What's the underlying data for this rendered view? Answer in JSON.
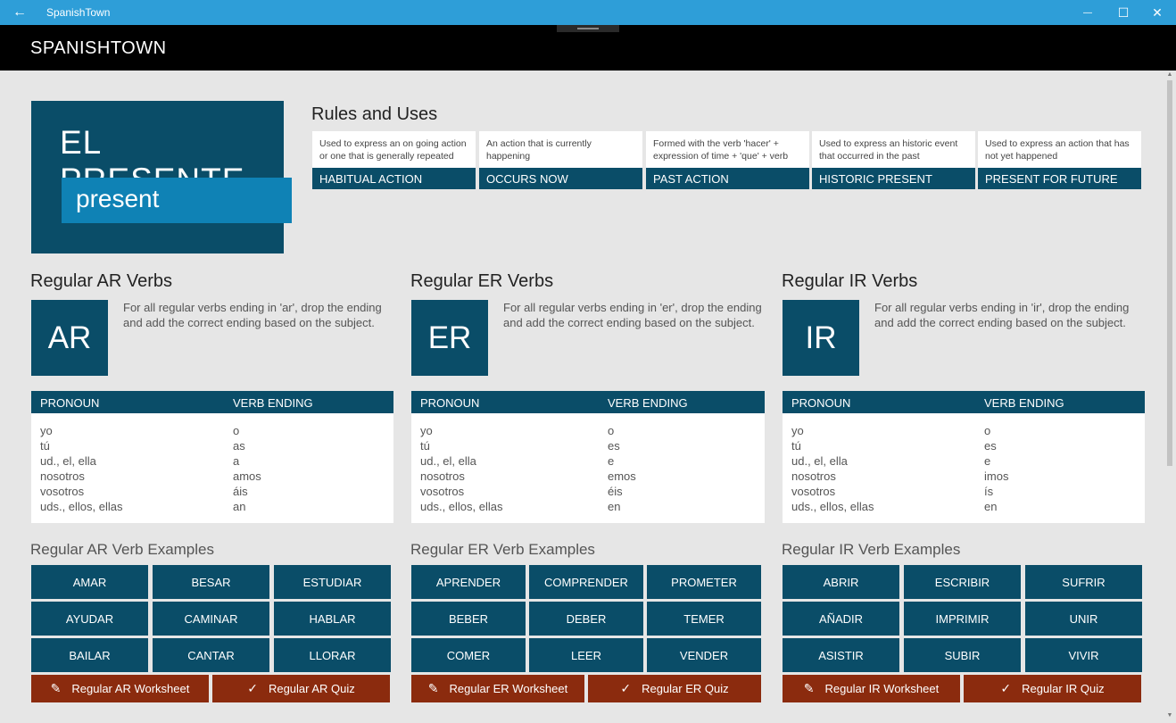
{
  "window": {
    "title": "SpanishTown",
    "back_icon": "←",
    "min_icon": "—",
    "max_icon": "☐",
    "close_icon": "✕"
  },
  "app": {
    "title": "SPANISHTOWN"
  },
  "hero": {
    "title": "EL PRESENTE",
    "subtitle": "present"
  },
  "rules": {
    "title": "Rules and Uses",
    "items": [
      {
        "desc": "Used to express an on going action or one that is generally repeated",
        "label": "HABITUAL ACTION"
      },
      {
        "desc": "An action that is currently happening",
        "label": "OCCURS NOW"
      },
      {
        "desc": "Formed with the verb 'hacer' + expression of time + 'que' + verb",
        "label": "PAST ACTION"
      },
      {
        "desc": "Used to express an historic event that occurred in the past",
        "label": "HISTORIC PRESENT"
      },
      {
        "desc": "Used to express an action that has not yet happened",
        "label": "PRESENT FOR FUTURE"
      }
    ]
  },
  "table_headers": {
    "pronoun": "PRONOUN",
    "ending": "VERB ENDING"
  },
  "pronouns": [
    "yo",
    "tú",
    "ud., el, ella",
    "nosotros",
    "vosotros",
    "uds., ellos, ellas"
  ],
  "columns": [
    {
      "heading": "Regular AR Verbs",
      "badge": "AR",
      "explanation": "For all regular verbs ending in 'ar', drop the ending and add the correct ending based on the subject.",
      "endings": [
        "o",
        "as",
        "a",
        "amos",
        "áis",
        "an"
      ],
      "examples_heading": "Regular AR Verb Examples",
      "verbs": [
        "AMAR",
        "BESAR",
        "ESTUDIAR",
        "AYUDAR",
        "CAMINAR",
        "HABLAR",
        "BAILAR",
        "CANTAR",
        "LLORAR"
      ],
      "worksheet": "Regular AR Worksheet",
      "quiz": "Regular AR Quiz"
    },
    {
      "heading": "Regular ER Verbs",
      "badge": "ER",
      "explanation": "For all regular verbs ending in 'er', drop the ending and add the correct ending based on the subject.",
      "endings": [
        "o",
        "es",
        "e",
        "emos",
        "éis",
        "en"
      ],
      "examples_heading": "Regular ER Verb Examples",
      "verbs": [
        "APRENDER",
        "COMPRENDER",
        "PROMETER",
        "BEBER",
        "DEBER",
        "TEMER",
        "COMER",
        "LEER",
        "VENDER"
      ],
      "worksheet": "Regular ER Worksheet",
      "quiz": "Regular ER Quiz"
    },
    {
      "heading": "Regular IR Verbs",
      "badge": "IR",
      "explanation": "For all regular verbs ending in 'ir', drop the ending and add the correct ending based on the subject.",
      "endings": [
        "o",
        "es",
        "e",
        "imos",
        "ís",
        "en"
      ],
      "examples_heading": "Regular IR Verb Examples",
      "verbs": [
        "ABRIR",
        "ESCRIBIR",
        "SUFRIR",
        "AÑADIR",
        "IMPRIMIR",
        "UNIR",
        "ASISTIR",
        "SUBIR",
        "VIVIR"
      ],
      "worksheet": "Regular IR Worksheet",
      "quiz": "Regular IR Quiz"
    }
  ],
  "icons": {
    "pencil": "pencil-icon",
    "check": "checkmark-icon"
  },
  "colors": {
    "accent": "#0a4d68",
    "accent_light": "#0f82b5",
    "action": "#8b2b0e",
    "titlebar": "#2e9ed8"
  }
}
